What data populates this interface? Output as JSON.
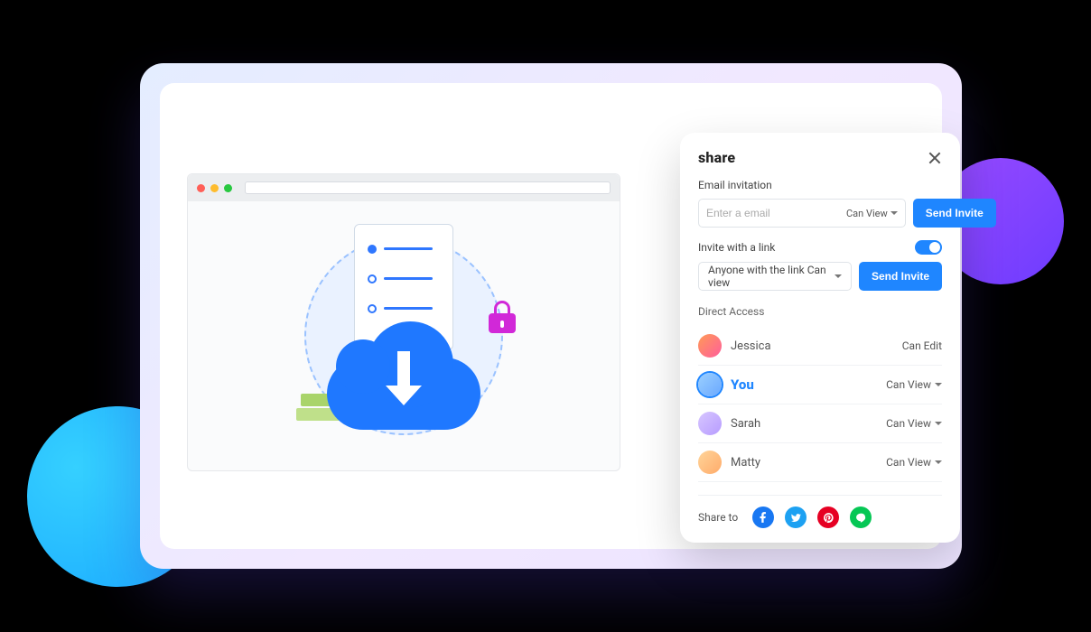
{
  "share": {
    "title": "share",
    "email_section_label": "Email invitation",
    "email_placeholder": "Enter a email",
    "email_permission": "Can View",
    "send_invite_label": "Send Invite",
    "link_section_label": "Invite with a link",
    "link_toggle_on": true,
    "link_select_value": "Anyone with the link Can view",
    "link_send_label": "Send Invite",
    "direct_access_label": "Direct Access",
    "people": [
      {
        "name": "Jessica",
        "permission": "Can Edit",
        "is_you": false,
        "has_caret": false
      },
      {
        "name": "You",
        "permission": "Can View",
        "is_you": true,
        "has_caret": true
      },
      {
        "name": "Sarah",
        "permission": "Can View",
        "is_you": false,
        "has_caret": true
      },
      {
        "name": "Matty",
        "permission": "Can View",
        "is_you": false,
        "has_caret": true
      }
    ],
    "share_to_label": "Share to",
    "social": {
      "facebook": "f",
      "twitter": "t",
      "pinterest": "p",
      "line": "L"
    }
  }
}
